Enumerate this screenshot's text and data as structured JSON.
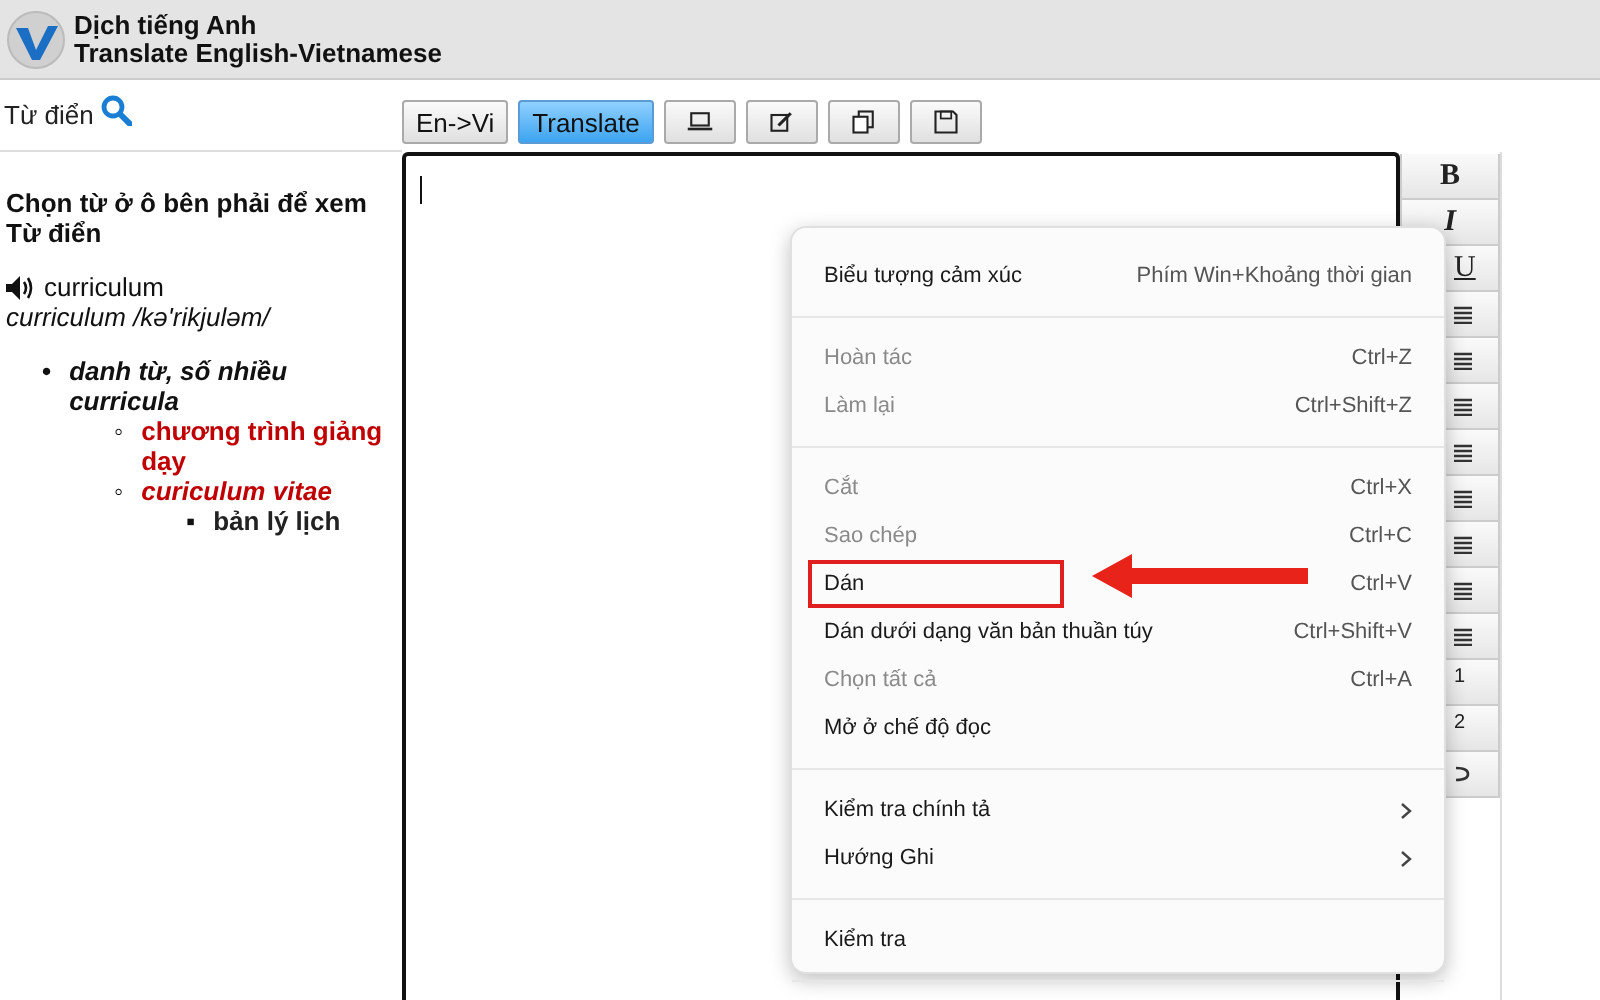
{
  "header": {
    "title": "Dịch tiếng Anh",
    "subtitle": "Translate English-Vietnamese"
  },
  "dictionary": {
    "label": "Từ điển",
    "hint": "Chọn từ ở ô bên phải để xem Từ điển",
    "word": "curriculum",
    "pronunciation": "curriculum /kə'rikjuləm/",
    "entries": [
      {
        "kind": "pos",
        "marker": "•",
        "text": "danh từ, số nhiều curricula",
        "children": [
          {
            "kind": "meaning",
            "marker": "◦",
            "text": "chương trình giảng dạy"
          },
          {
            "kind": "phrase",
            "marker": "◦",
            "text": "curiculum vitae",
            "children": [
              {
                "kind": "translation",
                "marker": "▪",
                "text": "bản lý lịch"
              }
            ]
          }
        ]
      }
    ]
  },
  "toolbar": {
    "buttons": [
      {
        "label": "En->Vi",
        "selected": false
      },
      {
        "label": "Translate",
        "selected": true
      }
    ]
  },
  "format_bar": {
    "text_buttons": [
      "B",
      "I",
      "U"
    ],
    "index_buttons": [
      "1",
      "2"
    ]
  },
  "context_menu": {
    "groups": [
      {
        "items": [
          {
            "label": "Biểu tượng cảm xúc",
            "shortcut": "Phím Win+Khoảng thời gian",
            "disabled": false,
            "highlighted": false
          }
        ]
      },
      {
        "items": [
          {
            "label": "Hoàn tác",
            "shortcut": "Ctrl+Z",
            "disabled": true,
            "highlighted": false
          },
          {
            "label": "Làm lại",
            "shortcut": "Ctrl+Shift+Z",
            "disabled": true,
            "highlighted": false
          }
        ]
      },
      {
        "items": [
          {
            "label": "Cắt",
            "shortcut": "Ctrl+X",
            "disabled": true,
            "highlighted": false
          },
          {
            "label": "Sao chép",
            "shortcut": "Ctrl+C",
            "disabled": true,
            "highlighted": false
          },
          {
            "label": "Dán",
            "shortcut": "Ctrl+V",
            "disabled": false,
            "highlighted": true
          },
          {
            "label": "Dán dưới dạng văn bản thuần túy",
            "shortcut": "Ctrl+Shift+V",
            "disabled": false,
            "highlighted": false
          },
          {
            "label": "Chọn tất cả",
            "shortcut": "Ctrl+A",
            "disabled": true,
            "highlighted": false
          },
          {
            "label": "Mở ở chế độ đọc",
            "disabled": false,
            "highlighted": false
          }
        ]
      },
      {
        "items": [
          {
            "label": "Kiểm tra chính tả",
            "disabled": false,
            "submenu": true,
            "highlighted": false
          },
          {
            "label": "Hướng Ghi",
            "disabled": false,
            "submenu": true,
            "highlighted": false
          }
        ]
      },
      {
        "items": [
          {
            "label": "Kiểm tra",
            "disabled": false,
            "highlighted": false
          }
        ]
      }
    ]
  }
}
